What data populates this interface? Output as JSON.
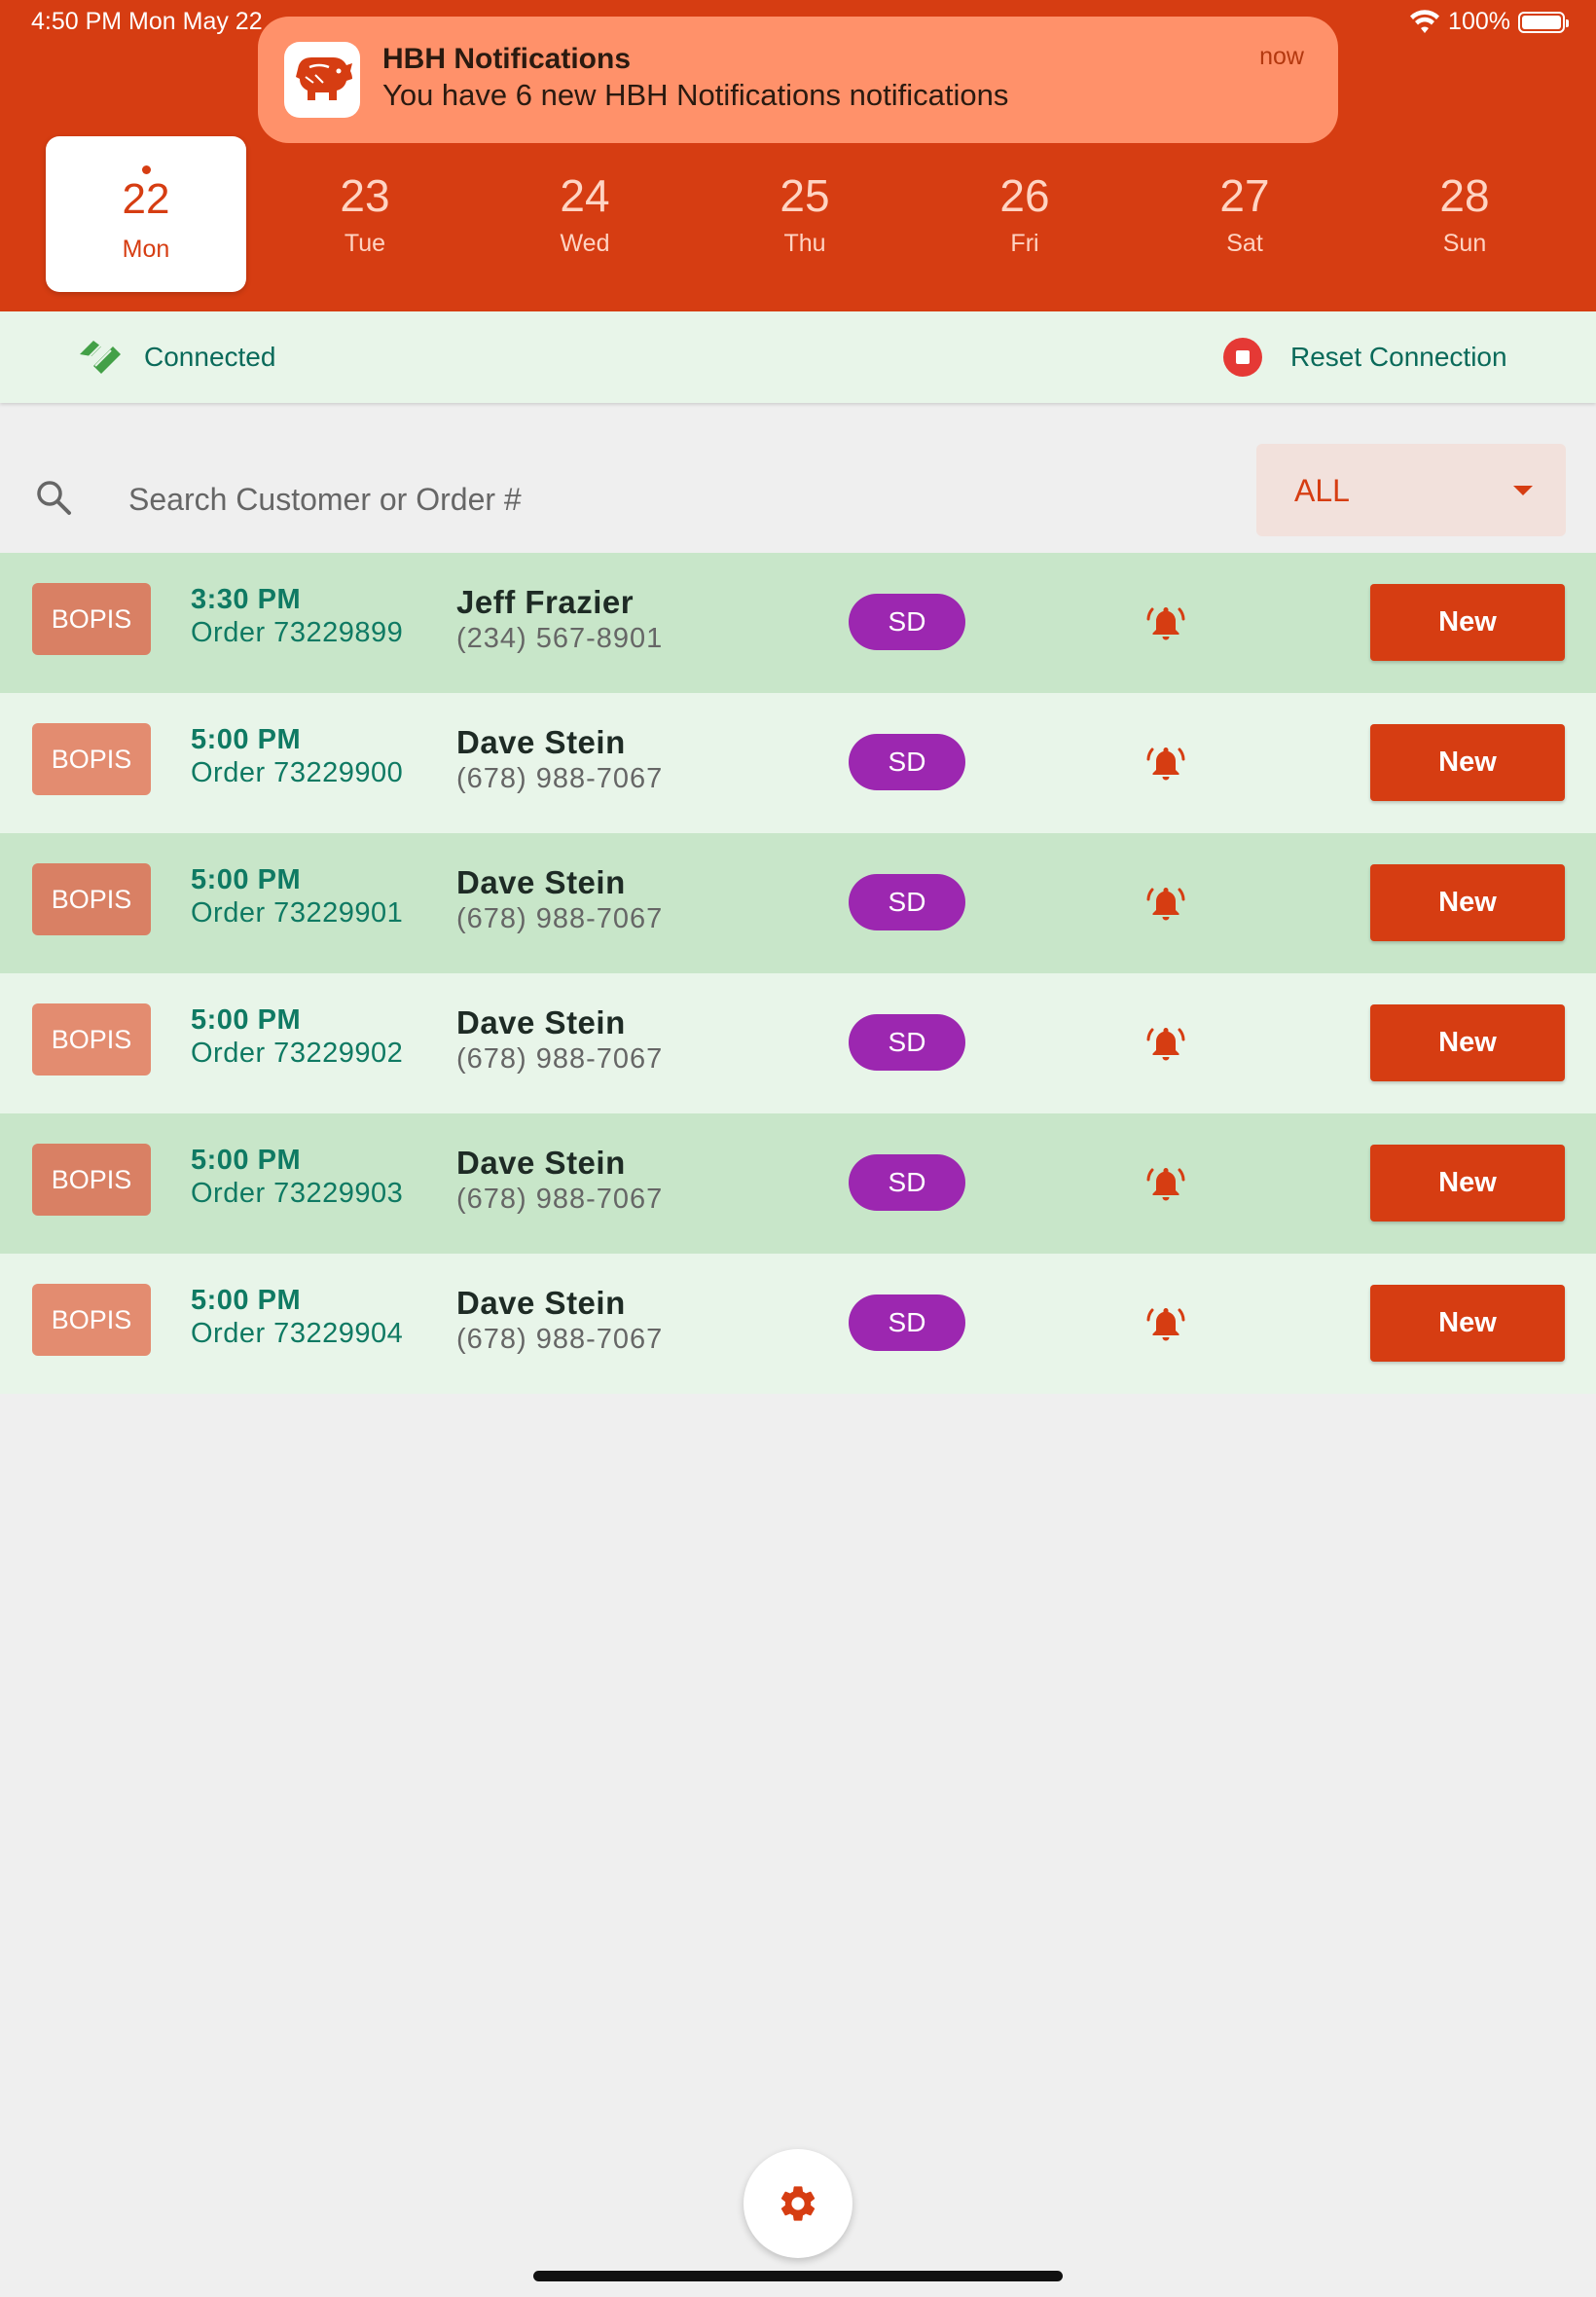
{
  "status": {
    "time": "4:50 PM   Mon May 22",
    "battery": "100%",
    "battery_level": 1.0
  },
  "notification": {
    "title": "HBH Notifications",
    "body": "You have 6 new HBH Notifications notifications",
    "time": "now",
    "icon": "pig-logo-icon"
  },
  "days": [
    {
      "num": "22",
      "name": "Mon",
      "selected": true
    },
    {
      "num": "23",
      "name": "Tue"
    },
    {
      "num": "24",
      "name": "Wed"
    },
    {
      "num": "25",
      "name": "Thu"
    },
    {
      "num": "26",
      "name": "Fri"
    },
    {
      "num": "27",
      "name": "Sat"
    },
    {
      "num": "28",
      "name": "Sun"
    }
  ],
  "connection": {
    "status": "Connected",
    "reset_label": "Reset Connection"
  },
  "search": {
    "placeholder": "Search Customer or Order #",
    "value": ""
  },
  "filter": {
    "selected": "ALL"
  },
  "orders": [
    {
      "type": "BOPIS",
      "time": "3:30 PM",
      "order": "Order 73229899",
      "name": "Jeff Frazier",
      "phone": "(234) 567-8901",
      "badge": "SD",
      "status": "New"
    },
    {
      "type": "BOPIS",
      "time": "5:00 PM",
      "order": "Order 73229900",
      "name": "Dave Stein",
      "phone": "(678) 988-7067",
      "badge": "SD",
      "status": "New"
    },
    {
      "type": "BOPIS",
      "time": "5:00 PM",
      "order": "Order 73229901",
      "name": "Dave Stein",
      "phone": "(678) 988-7067",
      "badge": "SD",
      "status": "New"
    },
    {
      "type": "BOPIS",
      "time": "5:00 PM",
      "order": "Order 73229902",
      "name": "Dave Stein",
      "phone": "(678) 988-7067",
      "badge": "SD",
      "status": "New"
    },
    {
      "type": "BOPIS",
      "time": "5:00 PM",
      "order": "Order 73229903",
      "name": "Dave Stein",
      "phone": "(678) 988-7067",
      "badge": "SD",
      "status": "New"
    },
    {
      "type": "BOPIS",
      "time": "5:00 PM",
      "order": "Order 73229904",
      "name": "Dave Stein",
      "phone": "(678) 988-7067",
      "badge": "SD",
      "status": "New"
    }
  ],
  "colors": {
    "brand": "#d63d12",
    "badge": "#9c27b0",
    "row_dark": "#c8e6c9",
    "row_light": "#e8f5e9"
  },
  "icons": {
    "search": "search-icon",
    "settings": "gear-icon",
    "bell": "bell-ringing-icon",
    "connected": "handshake-icon",
    "reset": "stop-icon"
  }
}
